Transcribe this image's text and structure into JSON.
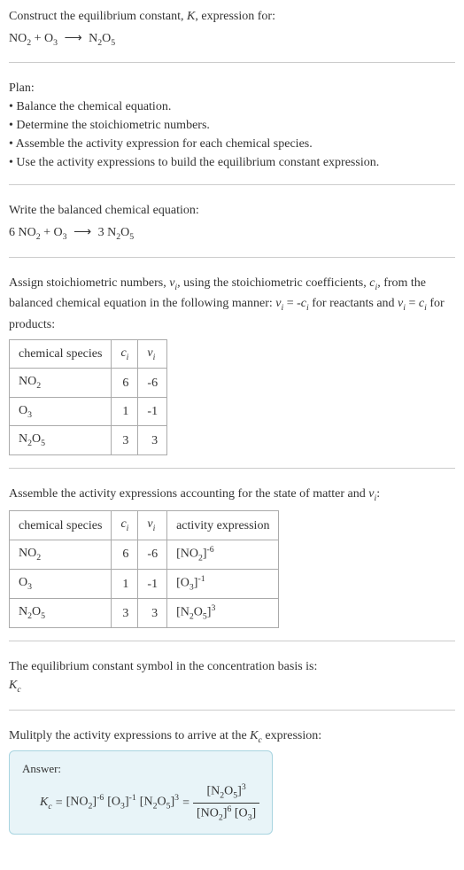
{
  "header": {
    "prompt": "Construct the equilibrium constant, K, expression for:",
    "equation_lhs": "NO₂ + O₃",
    "equation_rhs": "N₂O₅"
  },
  "plan": {
    "title": "Plan:",
    "items": [
      "Balance the chemical equation.",
      "Determine the stoichiometric numbers.",
      "Assemble the activity expression for each chemical species.",
      "Use the activity expressions to build the equilibrium constant expression."
    ]
  },
  "balanced": {
    "prompt": "Write the balanced chemical equation:",
    "equation_lhs": "6 NO₂ + O₃",
    "equation_rhs": "3 N₂O₅"
  },
  "stoich": {
    "intro": "Assign stoichiometric numbers, νᵢ, using the stoichiometric coefficients, cᵢ, from the balanced chemical equation in the following manner: νᵢ = -cᵢ for reactants and νᵢ = cᵢ for products:",
    "headers": [
      "chemical species",
      "cᵢ",
      "νᵢ"
    ],
    "rows": [
      {
        "species": "NO₂",
        "c": "6",
        "v": "-6"
      },
      {
        "species": "O₃",
        "c": "1",
        "v": "-1"
      },
      {
        "species": "N₂O₅",
        "c": "3",
        "v": "3"
      }
    ]
  },
  "activity": {
    "intro": "Assemble the activity expressions accounting for the state of matter and νᵢ:",
    "headers": [
      "chemical species",
      "cᵢ",
      "νᵢ",
      "activity expression"
    ],
    "rows": [
      {
        "species": "NO₂",
        "c": "6",
        "v": "-6",
        "expr_base": "[NO₂]",
        "expr_exp": "-6"
      },
      {
        "species": "O₃",
        "c": "1",
        "v": "-1",
        "expr_base": "[O₃]",
        "expr_exp": "-1"
      },
      {
        "species": "N₂O₅",
        "c": "3",
        "v": "3",
        "expr_base": "[N₂O₅]",
        "expr_exp": "3"
      }
    ]
  },
  "symbol": {
    "line1": "The equilibrium constant symbol in the concentration basis is:",
    "line2": "K_c"
  },
  "multiply": {
    "intro": "Mulitply the activity expressions to arrive at the K_c expression:"
  },
  "answer": {
    "label": "Answer:",
    "kc": "K_c",
    "terms": [
      {
        "base": "[NO₂]",
        "exp": "-6"
      },
      {
        "base": "[O₃]",
        "exp": "-1"
      },
      {
        "base": "[N₂O₅]",
        "exp": "3"
      }
    ],
    "fraction": {
      "num": [
        {
          "base": "[N₂O₅]",
          "exp": "3"
        }
      ],
      "den": [
        {
          "base": "[NO₂]",
          "exp": "6"
        },
        {
          "base": "[O₃]",
          "exp": ""
        }
      ]
    }
  },
  "chart_data": {
    "type": "table",
    "tables": [
      {
        "title": "Stoichiometric numbers",
        "headers": [
          "chemical species",
          "c_i",
          "ν_i"
        ],
        "rows": [
          [
            "NO2",
            6,
            -6
          ],
          [
            "O3",
            1,
            -1
          ],
          [
            "N2O5",
            3,
            3
          ]
        ]
      },
      {
        "title": "Activity expressions",
        "headers": [
          "chemical species",
          "c_i",
          "ν_i",
          "activity expression"
        ],
        "rows": [
          [
            "NO2",
            6,
            -6,
            "[NO2]^-6"
          ],
          [
            "O3",
            1,
            -1,
            "[O3]^-1"
          ],
          [
            "N2O5",
            3,
            3,
            "[N2O5]^3"
          ]
        ]
      }
    ]
  }
}
